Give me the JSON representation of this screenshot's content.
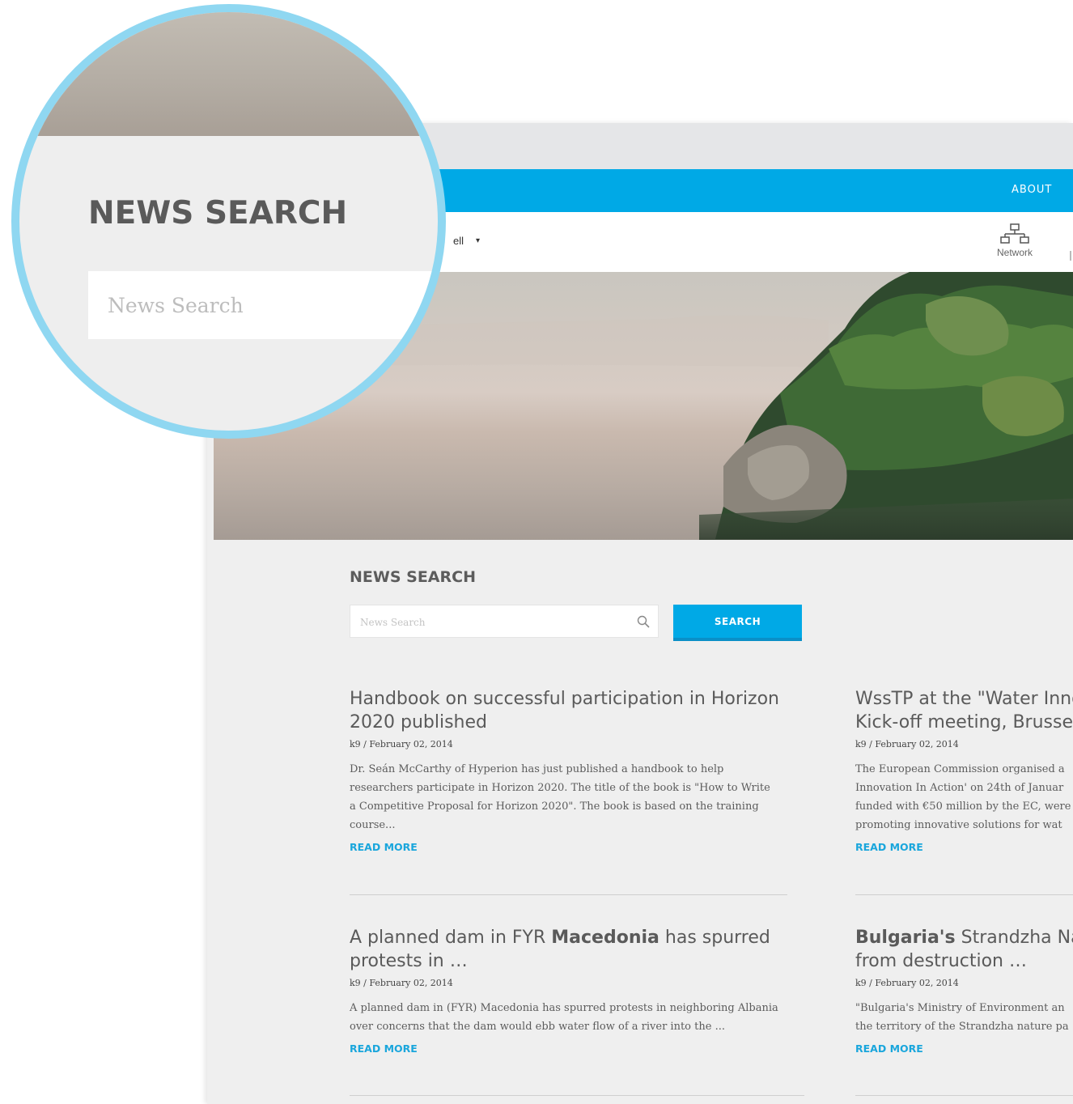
{
  "nav": {
    "about_label": "ABOUT"
  },
  "subbar": {
    "partial_text": "ell",
    "caret": "▾",
    "network_label": "Network"
  },
  "news_search": {
    "title": "NEWS SEARCH",
    "placeholder": "News Search",
    "button_label": "SEARCH"
  },
  "magnifier": {
    "title": "NEWS SEARCH",
    "placeholder": "News Search"
  },
  "articles": [
    {
      "title_lines": [
        "Handbook on successful participation in Horizon",
        "2020 published"
      ],
      "meta": "k9 / February 02, 2014",
      "excerpt_lines": [
        "Dr. Seán McCarthy of Hyperion has just published a handbook to help",
        "researchers participate in Horizon 2020. The title of the book is \"How to Write",
        "a Competitive Proposal for Horizon 2020\". The book is based on the training",
        "course..."
      ],
      "read_more": "READ MORE"
    },
    {
      "title_lines": [
        "WssTP at the \"Water Inno",
        "Kick-off meeting, Brusse"
      ],
      "meta": "k9 / February 02, 2014",
      "excerpt_lines": [
        "The European Commission organised a",
        "Innovation In Action' on 24th of Januar",
        "funded with €50 million by the EC, were",
        "promoting innovative solutions for wat"
      ],
      "read_more": "READ MORE"
    },
    {
      "title_parts": [
        {
          "text": "A planned dam in FYR ",
          "bold": false
        },
        {
          "text": "Macedonia",
          "bold": true
        },
        {
          "text": " has spurred",
          "bold": false
        }
      ],
      "title_line2": "protests in …",
      "meta": "k9 / February 02, 2014",
      "excerpt_lines": [
        "A planned dam in (FYR) Macedonia has spurred protests in neighboring Albania",
        "over concerns that the dam would ebb water flow of a river into the ..."
      ],
      "read_more": "READ MORE"
    },
    {
      "title_parts": [
        {
          "text": "Bulgaria's",
          "bold": true
        },
        {
          "text": " Strandzha Nat",
          "bold": false
        }
      ],
      "title_line2": "from destruction …",
      "meta": "k9 / February 02, 2014",
      "excerpt_lines": [
        "\"Bulgaria's Ministry of Environment an",
        "the territory of the Strandzha nature pa"
      ],
      "read_more": "READ MORE"
    }
  ],
  "colors": {
    "accent": "#00a9e6",
    "magnifier_ring": "#8fd7f1",
    "page_bg": "#efefef"
  }
}
